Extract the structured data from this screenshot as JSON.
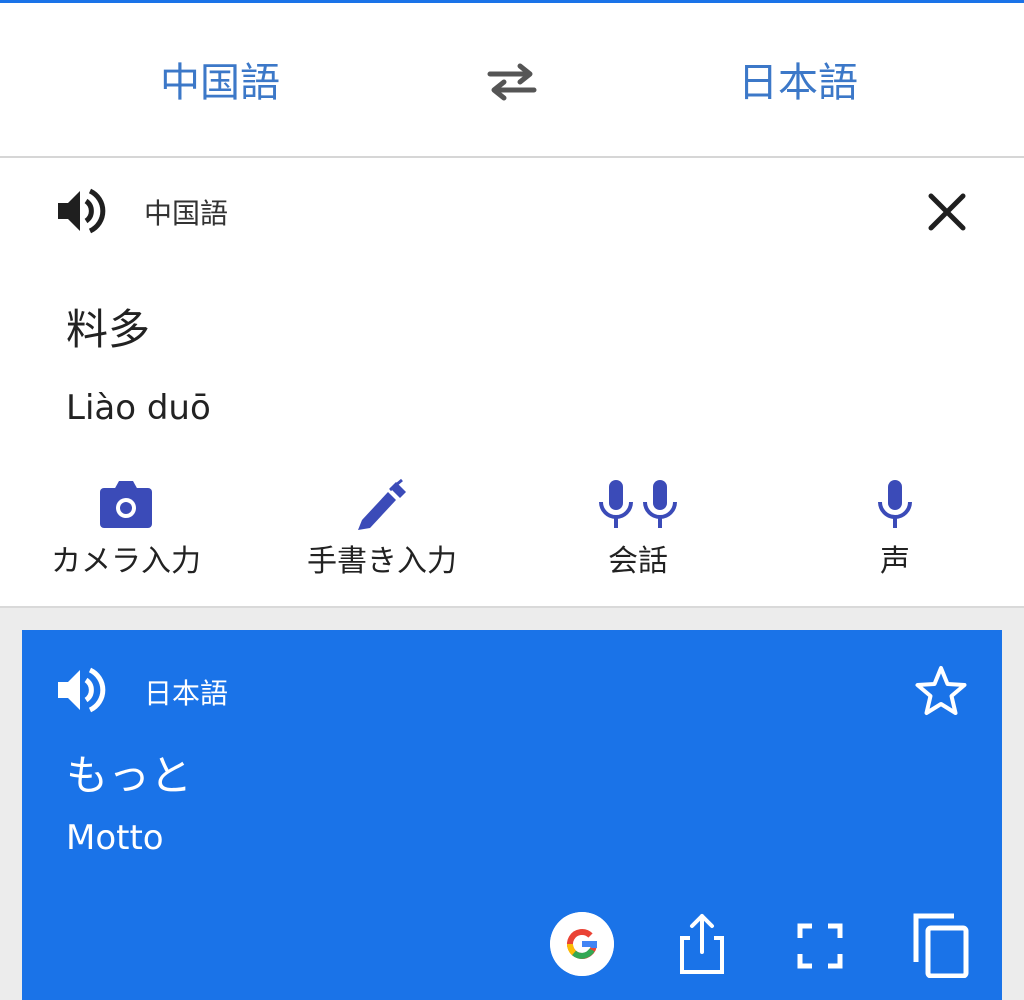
{
  "header": {
    "source_lang": "中国語",
    "target_lang": "日本語",
    "swap_icon": "swap-arrows-icon"
  },
  "input": {
    "lang_label": "中国語",
    "text": "料多",
    "romanization": "Liào duō",
    "speaker_icon": "speaker-icon",
    "close_icon": "close-icon"
  },
  "tools": [
    {
      "label": "カメラ入力",
      "icon": "camera-icon"
    },
    {
      "label": "手書き入力",
      "icon": "pen-icon"
    },
    {
      "label": "会話",
      "icon": "dual-microphone-icon"
    },
    {
      "label": "声",
      "icon": "microphone-icon"
    }
  ],
  "result": {
    "lang_label": "日本語",
    "text": "もっと",
    "romanization": "Motto",
    "speaker_icon": "speaker-icon",
    "star_icon": "star-icon",
    "actions": [
      "google-icon",
      "share-icon",
      "fullscreen-icon",
      "copy-icon"
    ]
  },
  "colors": {
    "accent": "#1a73e8",
    "lang_text": "#3c78c8",
    "tool_icon": "#3b4bb8"
  }
}
